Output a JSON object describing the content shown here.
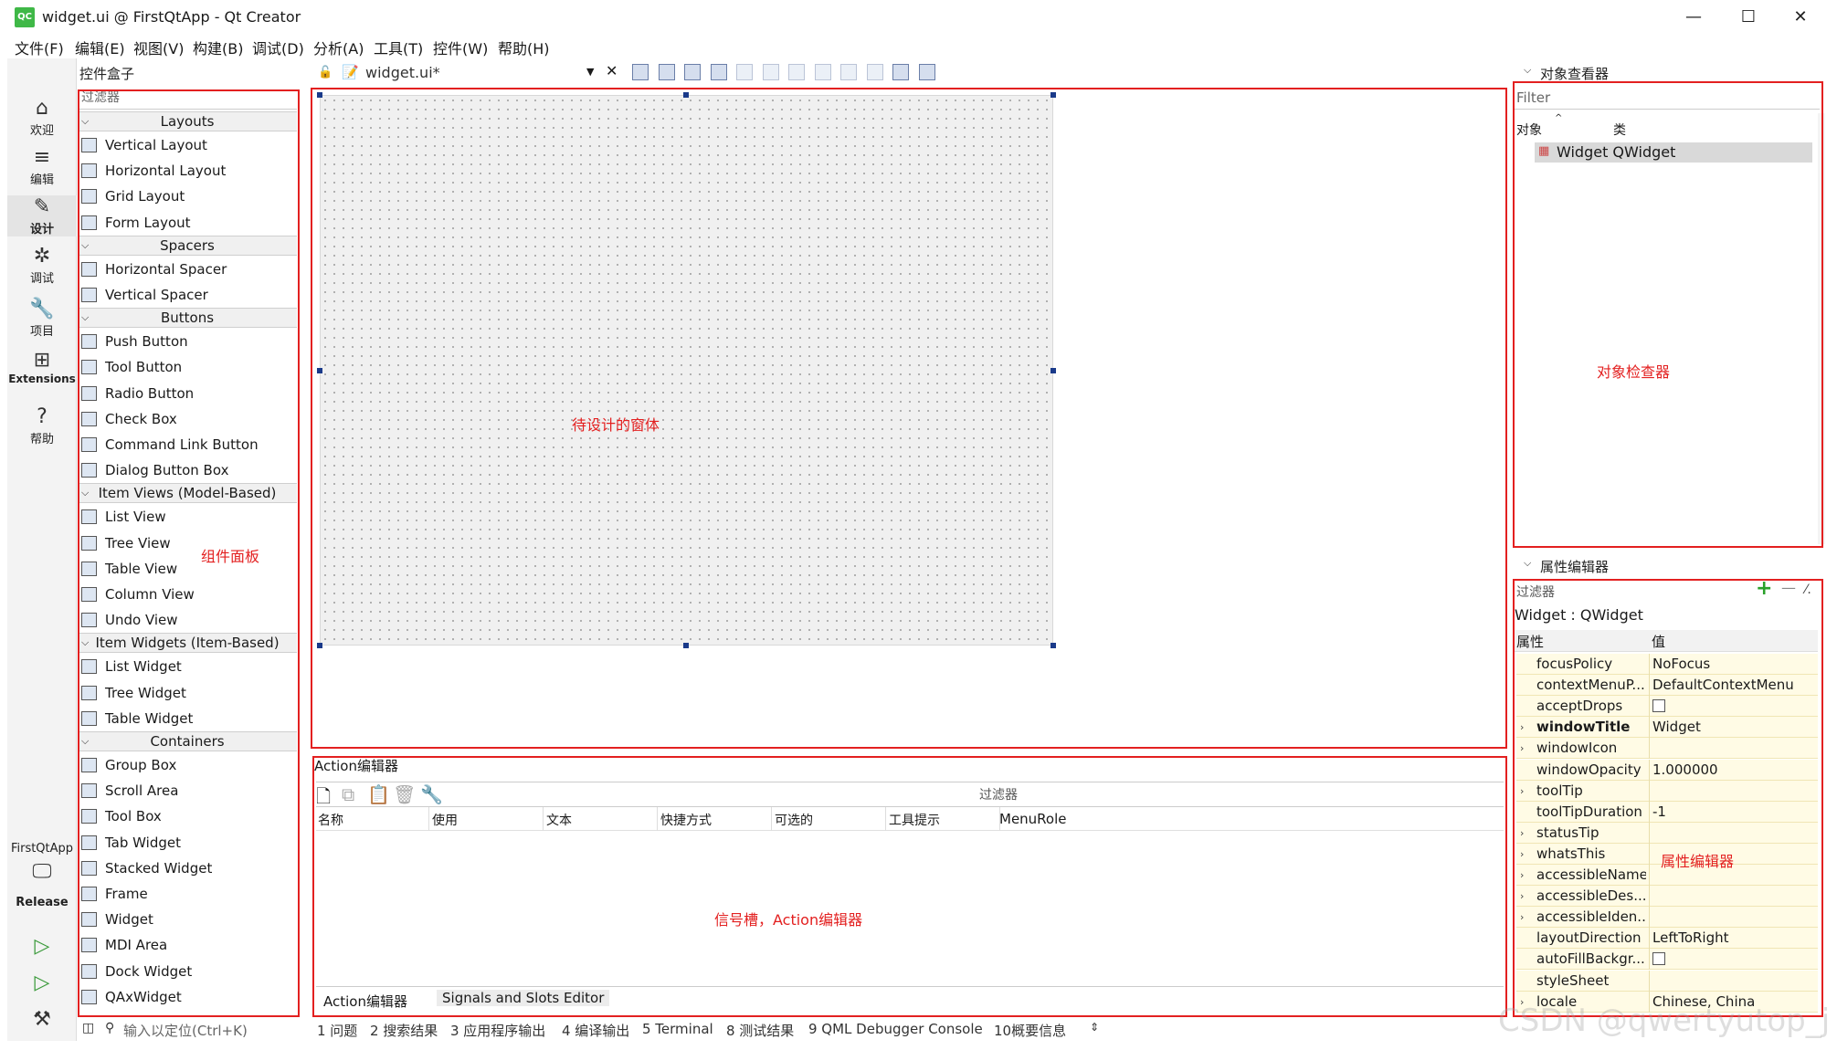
{
  "window": {
    "title": "widget.ui @ FirstQtApp - Qt Creator",
    "app_icon": "QC",
    "minimize": "—",
    "maximize": "☐",
    "close": "✕"
  },
  "menubar": [
    "文件(F)",
    "编辑(E)",
    "视图(V)",
    "构建(B)",
    "调试(D)",
    "分析(A)",
    "工具(T)",
    "控件(W)",
    "帮助(H)"
  ],
  "modes": [
    {
      "label": "欢迎",
      "icon": "home-icon",
      "glyph": "⌂"
    },
    {
      "label": "编辑",
      "icon": "edit-icon",
      "glyph": "≡"
    },
    {
      "label": "设计",
      "icon": "design-icon",
      "glyph": "✎"
    },
    {
      "label": "调试",
      "icon": "debug-icon",
      "glyph": "✲"
    },
    {
      "label": "项目",
      "icon": "wrench-icon",
      "glyph": "🔧"
    },
    {
      "label": "Extensions",
      "icon": "extensions-icon",
      "glyph": "⊞"
    },
    {
      "label": "帮助",
      "icon": "help-icon",
      "glyph": "?"
    }
  ],
  "kit": {
    "project": "FirstQtApp",
    "config": "Release"
  },
  "widget_box": {
    "title": "控件盒子",
    "filter_placeholder": "过滤器",
    "categories": [
      {
        "name": "Layouts",
        "items": [
          "Vertical Layout",
          "Horizontal Layout",
          "Grid Layout",
          "Form Layout"
        ]
      },
      {
        "name": "Spacers",
        "items": [
          "Horizontal Spacer",
          "Vertical Spacer"
        ]
      },
      {
        "name": "Buttons",
        "items": [
          "Push Button",
          "Tool Button",
          "Radio Button",
          "Check Box",
          "Command Link Button",
          "Dialog Button Box"
        ]
      },
      {
        "name": "Item Views (Model-Based)",
        "items": [
          "List View",
          "Tree View",
          "Table View",
          "Column View",
          "Undo View"
        ]
      },
      {
        "name": "Item Widgets (Item-Based)",
        "items": [
          "List Widget",
          "Tree Widget",
          "Table Widget"
        ]
      },
      {
        "name": "Containers",
        "items": [
          "Group Box",
          "Scroll Area",
          "Tool Box",
          "Tab Widget",
          "Stacked Widget",
          "Frame",
          "Widget",
          "MDI Area",
          "Dock Widget",
          "QAxWidget"
        ]
      }
    ]
  },
  "doc_tab": {
    "filename": "widget.ui*"
  },
  "annotations": {
    "widget_panel": "组件面板",
    "form": "待设计的窗体",
    "object_inspector": "对象检查器",
    "property_editor": "属性编辑器",
    "action_editor": "信号槽，Action编辑器"
  },
  "action_editor": {
    "title": "Action编辑器",
    "filter_label": "过滤器",
    "columns": [
      "名称",
      "使用",
      "文本",
      "快捷方式",
      "可选的",
      "工具提示",
      "MenuRole"
    ],
    "tabs": [
      "Action编辑器",
      "Signals and Slots Editor"
    ]
  },
  "object_inspector": {
    "title": "对象查看器",
    "filter_placeholder": "Filter",
    "col_object": "对象",
    "col_class": "类",
    "row": "Widget QWidget"
  },
  "property_editor": {
    "title": "属性编辑器",
    "filter_placeholder": "过滤器",
    "add": "+",
    "remove": "—",
    "config": "⁄.",
    "context": "Widget : QWidget",
    "col_property": "属性",
    "col_value": "值",
    "rows": [
      {
        "name": "focusPolicy",
        "value": "NoFocus",
        "exp": false,
        "bold": false,
        "cb": false
      },
      {
        "name": "contextMenuP...",
        "value": "DefaultContextMenu",
        "exp": false,
        "bold": false,
        "cb": false
      },
      {
        "name": "acceptDrops",
        "value": "",
        "exp": false,
        "bold": false,
        "cb": true
      },
      {
        "name": "windowTitle",
        "value": "Widget",
        "exp": true,
        "bold": true,
        "cb": false
      },
      {
        "name": "windowIcon",
        "value": "",
        "exp": true,
        "bold": false,
        "cb": false
      },
      {
        "name": "windowOpacity",
        "value": "1.000000",
        "exp": false,
        "bold": false,
        "cb": false
      },
      {
        "name": "toolTip",
        "value": "",
        "exp": true,
        "bold": false,
        "cb": false
      },
      {
        "name": "toolTipDuration",
        "value": "-1",
        "exp": false,
        "bold": false,
        "cb": false
      },
      {
        "name": "statusTip",
        "value": "",
        "exp": true,
        "bold": false,
        "cb": false
      },
      {
        "name": "whatsThis",
        "value": "",
        "exp": true,
        "bold": false,
        "cb": false
      },
      {
        "name": "accessibleName",
        "value": "",
        "exp": true,
        "bold": false,
        "cb": false
      },
      {
        "name": "accessibleDes...",
        "value": "",
        "exp": true,
        "bold": false,
        "cb": false
      },
      {
        "name": "accessibleIden...",
        "value": "",
        "exp": true,
        "bold": false,
        "cb": false
      },
      {
        "name": "layoutDirection",
        "value": "LeftToRight",
        "exp": false,
        "bold": false,
        "cb": false
      },
      {
        "name": "autoFillBackgr...",
        "value": "",
        "exp": false,
        "bold": false,
        "cb": true
      },
      {
        "name": "styleSheet",
        "value": "",
        "exp": false,
        "bold": false,
        "cb": false
      },
      {
        "name": "locale",
        "value": "Chinese, China",
        "exp": true,
        "bold": false,
        "cb": false
      }
    ]
  },
  "statusbar": {
    "search_placeholder": "输入以定位(Ctrl+K)",
    "panes": [
      "1 问题",
      "2 搜索结果",
      "3 应用程序输出",
      "4 编译输出",
      "5 Terminal",
      "8 测试结果",
      "9 QML Debugger Console",
      "10概要信息"
    ]
  },
  "watermark": "CSDN @qwertyutop_j",
  "colors": {
    "annotation_red": "#e32020",
    "property_row_bg": "#fffbe5",
    "form_bg": "#f0f0f0",
    "handle": "#1a3a8a"
  }
}
